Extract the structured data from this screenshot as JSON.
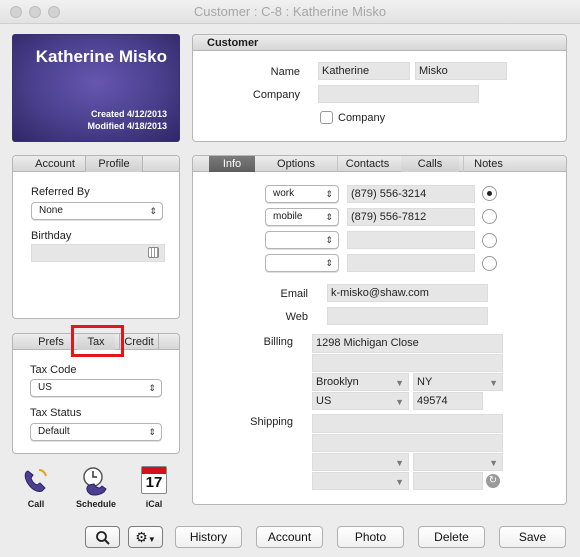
{
  "window": {
    "title": "Customer : C-8 : Katherine Misko"
  },
  "header": {
    "name": "Katherine Misko",
    "created": "Created 4/12/2013",
    "modified": "Modified 4/18/2013"
  },
  "customer": {
    "section_title": "Customer",
    "name_label": "Name",
    "first_name": "Katherine",
    "last_name": "Misko",
    "company_label": "Company",
    "company_value": "",
    "company_checkbox_label": "Company"
  },
  "left_tabs": {
    "account": "Account",
    "profile": "Profile"
  },
  "profile": {
    "referred_by_label": "Referred By",
    "referred_by_value": "None",
    "birthday_label": "Birthday",
    "birthday_value": ""
  },
  "tax_tabs": {
    "prefs": "Prefs",
    "tax": "Tax",
    "credit": "Credit"
  },
  "tax": {
    "tax_code_label": "Tax Code",
    "tax_code_value": "US",
    "tax_status_label": "Tax Status",
    "tax_status_value": "Default"
  },
  "tools": {
    "call": "Call",
    "schedule": "Schedule",
    "ical": "iCal",
    "ical_day": "17"
  },
  "info_tabs": {
    "info": "Info",
    "options": "Options",
    "contacts": "Contacts",
    "calls": "Calls",
    "notes": "Notes"
  },
  "phones": [
    {
      "type": "work",
      "number": "(879) 556-3214",
      "primary": true
    },
    {
      "type": "mobile",
      "number": "(879) 556-7812",
      "primary": false
    },
    {
      "type": "",
      "number": "",
      "primary": false
    },
    {
      "type": "",
      "number": "",
      "primary": false
    }
  ],
  "contact": {
    "email_label": "Email",
    "email": "k-misko@shaw.com",
    "web_label": "Web",
    "web": ""
  },
  "billing": {
    "label": "Billing",
    "street1": "1298 Michigan Close",
    "street2": "",
    "city": "Brooklyn",
    "state": "NY",
    "country": "US",
    "zip": "49574"
  },
  "shipping": {
    "label": "Shipping",
    "street1": "",
    "street2": "",
    "city": "",
    "state": "",
    "country": "",
    "zip": ""
  },
  "buttons": {
    "history": "History",
    "account": "Account",
    "photo": "Photo",
    "delete": "Delete",
    "save": "Save"
  },
  "colors": {
    "header_bg": "#4a3f8c",
    "highlight": "#e0171f"
  }
}
